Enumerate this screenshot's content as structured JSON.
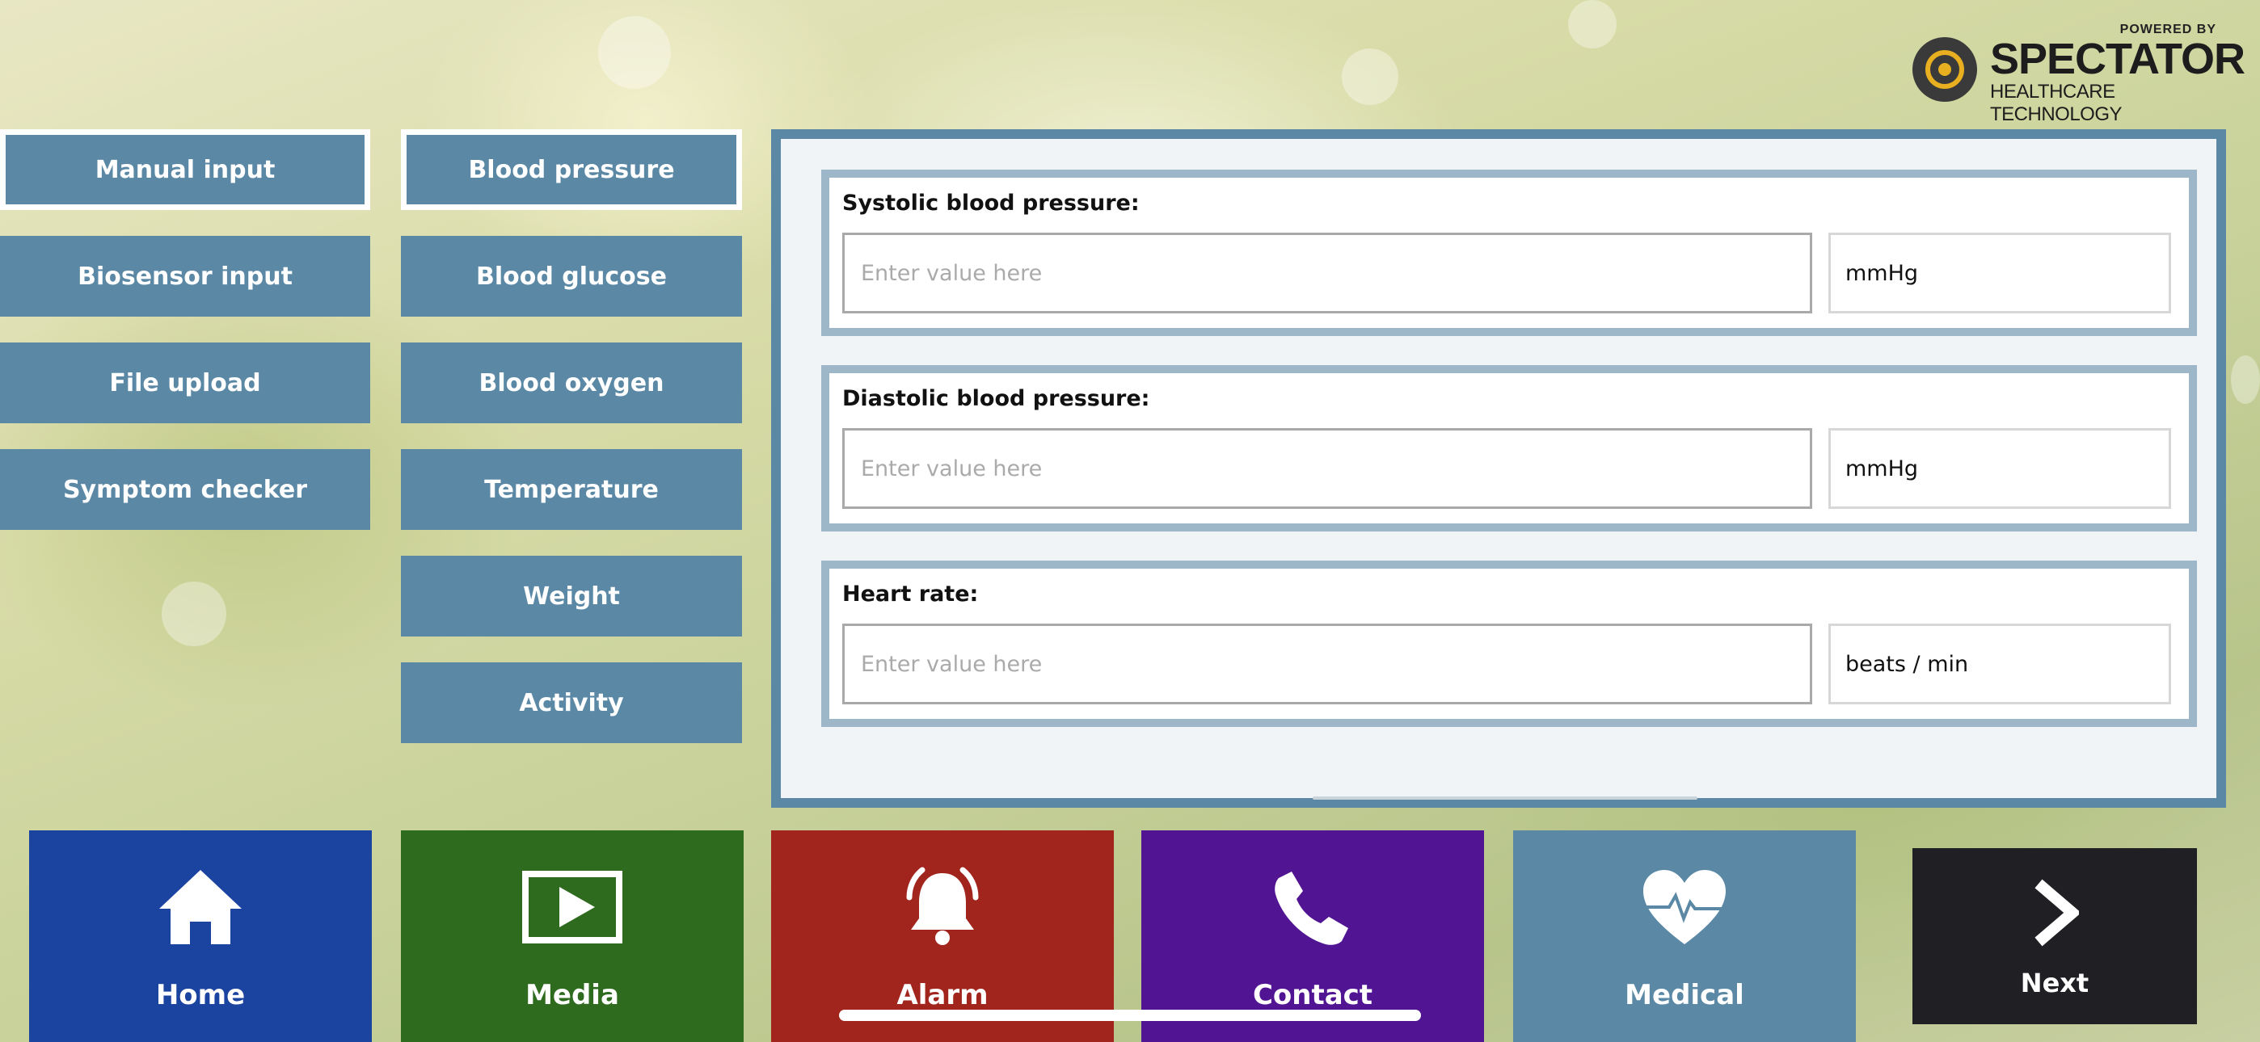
{
  "logo": {
    "powered_by": "POWERED BY",
    "brand": "SPECTATOR",
    "tagline": "HEALTHCARE TECHNOLOGY"
  },
  "input_methods": [
    {
      "label": "Manual input",
      "selected": true
    },
    {
      "label": "Biosensor input",
      "selected": false
    },
    {
      "label": "File upload",
      "selected": false
    },
    {
      "label": "Symptom checker",
      "selected": false
    }
  ],
  "measurements": [
    {
      "label": "Blood pressure",
      "selected": true
    },
    {
      "label": "Blood glucose",
      "selected": false
    },
    {
      "label": "Blood oxygen",
      "selected": false
    },
    {
      "label": "Temperature",
      "selected": false
    },
    {
      "label": "Weight",
      "selected": false
    },
    {
      "label": "Activity",
      "selected": false
    }
  ],
  "form": {
    "fields": [
      {
        "label": "Systolic blood pressure:",
        "value": "",
        "placeholder": "Enter value here",
        "unit": "mmHg"
      },
      {
        "label": "Diastolic blood pressure:",
        "value": "",
        "placeholder": "Enter value here",
        "unit": "mmHg"
      },
      {
        "label": "Heart rate:",
        "value": "",
        "placeholder": "Enter value here",
        "unit": "beats / min"
      }
    ]
  },
  "bottom_nav": [
    {
      "label": "Home",
      "icon": "home-icon",
      "color": "#1b44a0"
    },
    {
      "label": "Media",
      "icon": "play-icon",
      "color": "#2e6b1f"
    },
    {
      "label": "Alarm",
      "icon": "bell-icon",
      "color": "#a1251d"
    },
    {
      "label": "Contact",
      "icon": "phone-icon",
      "color": "#511594"
    },
    {
      "label": "Medical",
      "icon": "heart-pulse-icon",
      "color": "#5a88a5"
    }
  ],
  "next": {
    "label": "Next",
    "icon": "chevron-right-icon",
    "color": "#1f1f24"
  },
  "colors": {
    "button": "#5a88a5",
    "panel_border": "#5a88a5",
    "field_border": "#9db7c9"
  }
}
